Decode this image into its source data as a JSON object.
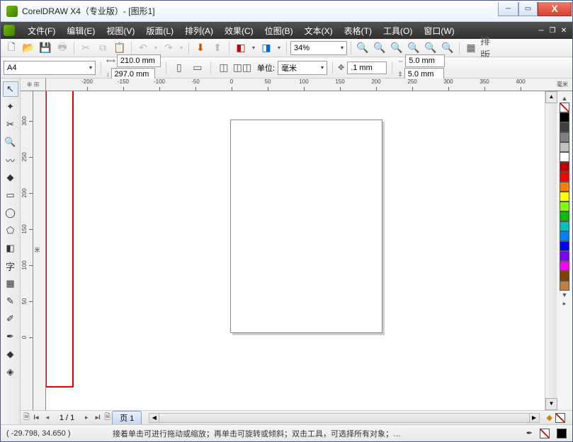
{
  "title": "CorelDRAW X4（专业版）- [图形1]",
  "menu": [
    "文件(F)",
    "编辑(E)",
    "视图(V)",
    "版面(L)",
    "排列(A)",
    "效果(C)",
    "位图(B)",
    "文本(X)",
    "表格(T)",
    "工具(O)",
    "窗口(W)"
  ],
  "toolbar": {
    "zoom_value": "34%",
    "typeset": "排版"
  },
  "propbar": {
    "paper": "A4",
    "width": "210.0 mm",
    "height": "297.0 mm",
    "unit_label": "单位:",
    "unit_value": "毫米",
    "nudge": ".1 mm",
    "dup_x": "5.0 mm",
    "dup_y": "5.0 mm"
  },
  "ruler": {
    "h_ticks": [
      -200,
      -150,
      -100,
      -50,
      0,
      50,
      100,
      150,
      200,
      250,
      300,
      350,
      400
    ],
    "h_unit": "毫米",
    "v_ticks": [
      300,
      250,
      200,
      150,
      100,
      50,
      0
    ],
    "v_unit": "米"
  },
  "tabs": {
    "page_counter": "1 / 1",
    "page_label": "页 1"
  },
  "statusbar": {
    "coords": "( -29.798, 34.650 )",
    "hint": "接着单击可进行拖动或缩放；再单击可旋转或倾斜；双击工具，可选择所有对象；…"
  },
  "palette": [
    "#000000",
    "#404040",
    "#808080",
    "#c0c0c0",
    "#ffffff",
    "#c00000",
    "#ff0000",
    "#ff8000",
    "#ffff00",
    "#80ff00",
    "#00c000",
    "#00c0c0",
    "#0080ff",
    "#0000ff",
    "#8000ff",
    "#ff00ff",
    "#804000",
    "#c08040"
  ]
}
